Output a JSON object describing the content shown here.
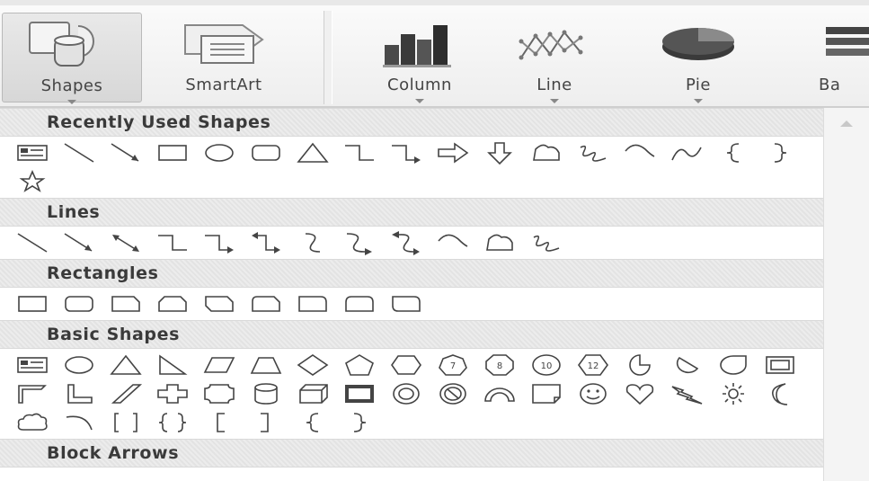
{
  "ribbon": {
    "buttons": [
      {
        "label": "Shapes",
        "icon": "shapes-icon",
        "active": true,
        "dropdown": true
      },
      {
        "label": "SmartArt",
        "icon": "smartart-icon",
        "active": false,
        "dropdown": false
      },
      {
        "label": "Column",
        "icon": "column-chart-icon",
        "active": false,
        "dropdown": true
      },
      {
        "label": "Line",
        "icon": "line-chart-icon",
        "active": false,
        "dropdown": true
      },
      {
        "label": "Pie",
        "icon": "pie-chart-icon",
        "active": false,
        "dropdown": true
      },
      {
        "label": "Ba",
        "icon": "bar-chart-icon",
        "active": false,
        "dropdown": true
      }
    ]
  },
  "gallery": {
    "sections": [
      {
        "title": "Recently Used Shapes",
        "shapes": [
          "text-box",
          "line",
          "arrow",
          "rectangle",
          "oval",
          "rounded-rectangle",
          "isosceles-triangle",
          "elbow-connector",
          "elbow-arrow-connector",
          "right-arrow",
          "down-arrow",
          "freeform",
          "scribble",
          "curve",
          "curve-2",
          "left-brace",
          "right-brace",
          "5-point-star"
        ]
      },
      {
        "title": "Lines",
        "shapes": [
          "line",
          "arrow",
          "double-arrow",
          "elbow-connector",
          "elbow-arrow-connector",
          "elbow-double-arrow-connector",
          "curved-connector",
          "curved-arrow-connector",
          "curved-double-arrow-connector",
          "curve",
          "freeform",
          "scribble"
        ]
      },
      {
        "title": "Rectangles",
        "shapes": [
          "rectangle",
          "rounded-rectangle",
          "snip-single-corner",
          "snip-same-side",
          "snip-diagonal",
          "snip-round",
          "round-single-corner",
          "round-same-side",
          "round-diagonal"
        ]
      },
      {
        "title": "Basic Shapes",
        "shapes": [
          "text-box",
          "oval",
          "isosceles-triangle",
          "right-triangle",
          "parallelogram",
          "trapezoid",
          "diamond",
          "pentagon",
          "hexagon",
          "heptagon",
          "octagon",
          "decagon",
          "dodecagon",
          "pie",
          "chord",
          "teardrop",
          "frame",
          "half-frame",
          "l-shape",
          "diagonal-stripe",
          "cross",
          "plaque",
          "can",
          "cube",
          "bevel",
          "donut",
          "no-symbol",
          "block-arc",
          "folded-corner",
          "smiley-face",
          "heart",
          "lightning-bolt",
          "sun",
          "moon",
          "cloud",
          "arc",
          "double-bracket",
          "double-brace",
          "left-bracket",
          "right-bracket",
          "left-brace",
          "right-brace"
        ]
      },
      {
        "title": "Block Arrows",
        "shapes": []
      }
    ],
    "polygon_labels": {
      "heptagon": "7",
      "octagon": "8",
      "decagon": "10",
      "dodecagon": "12"
    }
  }
}
